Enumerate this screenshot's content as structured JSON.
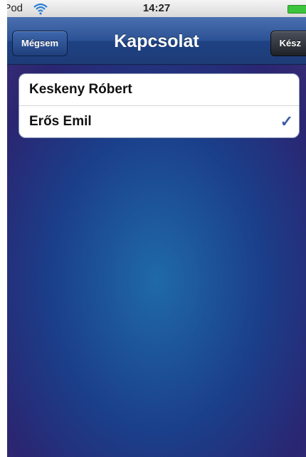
{
  "status_bar": {
    "carrier": "iPod",
    "time": "14:27",
    "icons": [
      "wifi-icon",
      "battery-icon"
    ],
    "battery_color": "#3cc43c"
  },
  "nav_bar": {
    "title": "Kapcsolat",
    "left_button": "Mégsem",
    "right_button": "Kész"
  },
  "contacts": [
    {
      "name": "Keskeny Róbert",
      "selected": false
    },
    {
      "name": "Erős Emil",
      "selected": true,
      "check_icon": "checkmark-icon",
      "check_glyph": "✓"
    }
  ],
  "colors": {
    "nav_bar": "#2c5296",
    "check": "#3d5fa1"
  }
}
